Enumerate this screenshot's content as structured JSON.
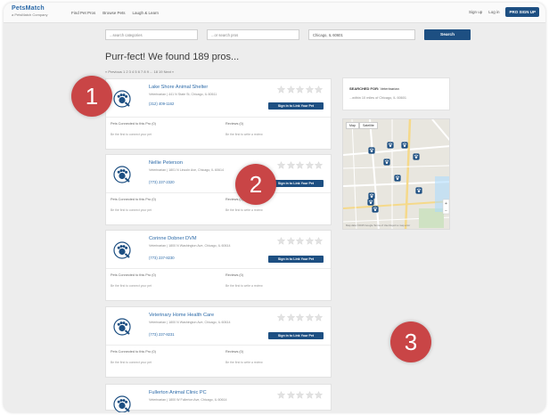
{
  "nav": {
    "logo": "PetsMatch",
    "logo_sub": "a PetsMatch Company",
    "links": [
      "Find Pet Pros",
      "Browse Pets",
      "Laugh & Learn"
    ],
    "sign_up": "Sign up",
    "log_in": "Log in",
    "pro_sign_up": "PRO SIGN UP"
  },
  "search": {
    "query_placeholder": "...search categories",
    "pros_placeholder": "...or search pros",
    "location_value": "Chicago, IL 60601",
    "button": "Search"
  },
  "results": {
    "title": "Purr-fect! We found 189 pros...",
    "pager": "« Previous 1 2 3 4 5 6 7 8 9 ... 18 19 Next »"
  },
  "labels": {
    "claim": "Sign in to Link Your Pet",
    "pets_connected": "Pets Connected to this Pro (0)",
    "pets_empty": "Be the first to connect your pet",
    "reviews": "Reviews (0)",
    "reviews_empty": "Be the first to write a review"
  },
  "cards": [
    {
      "name": "Lake Shore Animal Shelter",
      "addr": "Veterinarian | 441 N State St, Chicago, IL 60611",
      "phone": "(312) 409-1162"
    },
    {
      "name": "Nellie Peterson",
      "addr": "Veterinarian | 1801 N Lincoln Ave, Chicago, IL 60614",
      "phone": "(773) 237-2320"
    },
    {
      "name": "Corinne Dobner DVM",
      "addr": "Veterinarian | 1800 N Washington Ave, Chicago, IL 60614",
      "phone": "(773) 237-8230"
    },
    {
      "name": "Veterinary Home Health Care",
      "addr": "Veterinarian | 1800 N Washington Ave, Chicago, IL 60614",
      "phone": "(773) 237-8231"
    },
    {
      "name": "Fullerton Animal Clinic PC",
      "addr": "Veterinarian | 1800 W Fullerton Ave, Chicago, IL 60614",
      "phone": ""
    }
  ],
  "sidebar": {
    "searched_for_label": "SEARCHED FOR:",
    "searched_for_value": "Veterinarian",
    "searched_sub": "...within 10 miles of Chicago, IL 60601",
    "map_tab_map": "Map",
    "map_tab_satellite": "Satellite",
    "map_footer": "Map data ©2015 Google  Terms of Use  Report a map error"
  },
  "badges": [
    "1",
    "2",
    "3"
  ],
  "colors": {
    "brand": "#1d4f82",
    "link": "#2c6aa8",
    "badge": "#c94546"
  }
}
